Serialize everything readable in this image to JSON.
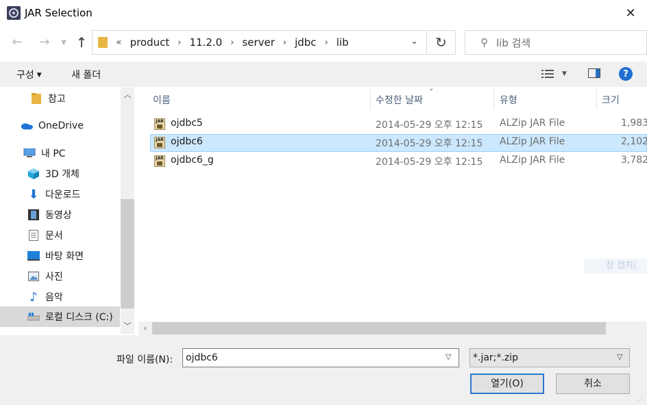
{
  "window": {
    "title": "JAR Selection",
    "close_glyph": "✕"
  },
  "address": {
    "overflow": "«",
    "crumbs": [
      "product",
      "11.2.0",
      "server",
      "jdbc",
      "lib"
    ],
    "search_placeholder": "lib 검색"
  },
  "toolbar": {
    "organize": "구성",
    "new_folder": "새 폴더"
  },
  "nav": {
    "items": [
      {
        "label": "참고",
        "icon": "folder-icon"
      },
      {
        "label": "OneDrive",
        "icon": "cloud-icon"
      },
      {
        "label": "내 PC",
        "icon": "computer-icon"
      },
      {
        "label": "3D 개체",
        "icon": "cube-icon"
      },
      {
        "label": "다운로드",
        "icon": "download-icon"
      },
      {
        "label": "동영상",
        "icon": "film-icon"
      },
      {
        "label": "문서",
        "icon": "document-icon"
      },
      {
        "label": "바탕 화면",
        "icon": "desktop-icon"
      },
      {
        "label": "사진",
        "icon": "picture-icon"
      },
      {
        "label": "음악",
        "icon": "music-icon"
      },
      {
        "label": "로컬 디스크 (C:)",
        "icon": "drive-icon",
        "selected": true
      }
    ]
  },
  "columns": {
    "name": "이름",
    "date": "수정한 날짜",
    "type": "유형",
    "size": "크기"
  },
  "files": [
    {
      "name": "ojdbc5",
      "date": "2014-05-29 오후 12:15",
      "type": "ALZip JAR File",
      "size": "1,983"
    },
    {
      "name": "ojdbc6",
      "date": "2014-05-29 오후 12:15",
      "type": "ALZip JAR File",
      "size": "2,102",
      "selected": true
    },
    {
      "name": "ojdbc6_g",
      "date": "2014-05-29 오후 12:15",
      "type": "ALZip JAR File",
      "size": "3,782"
    }
  ],
  "watermark": "창 캡처(",
  "bottom": {
    "filename_label": "파일 이름(N):",
    "filename_value": "ojdbc6",
    "filetype": "*.jar;*.zip",
    "open": "열기(O)",
    "cancel": "취소"
  },
  "colors": {
    "selection": "#cce8ff",
    "accent": "#2b78d0",
    "header_text": "#4c607a"
  }
}
